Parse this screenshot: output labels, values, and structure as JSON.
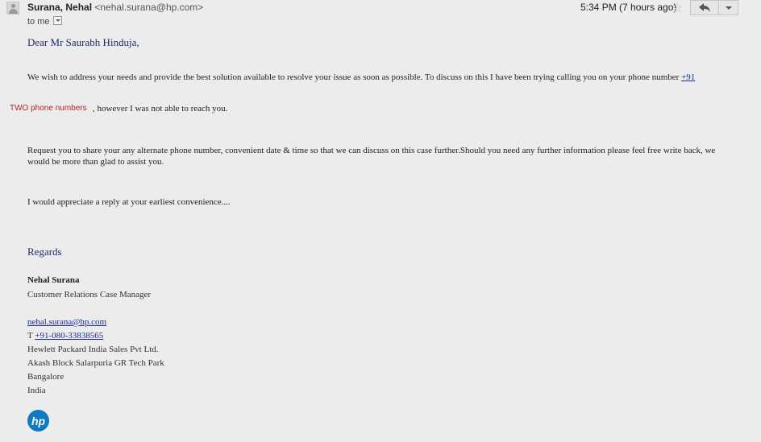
{
  "header": {
    "sender_name": "Surana, Nehal",
    "sender_email": "<nehal.surana@hp.com>",
    "recipient": "to me",
    "timestamp": "5:34 PM (7 hours ago)",
    "icons": {
      "avatar": "person-silhouette-icon",
      "details": "chevron-down-icon",
      "star": "star-icon",
      "reply": "reply-arrow-icon",
      "more": "dropdown-arrow-icon"
    }
  },
  "body": {
    "greeting": "Dear Mr Saurabh Hinduja,",
    "para1": "We wish to address your needs and provide the best solution available to resolve your issue as soon as possible. To discuss on this I have been trying calling you on your phone number",
    "para1_link": "+91",
    "redaction_note": "TWO phone numbers",
    "para1_cont": ", however I was not able to reach you.",
    "para2": "Request you to share your any alternate phone number, convenient date & time so that we can discuss on this case further.Should you need any further information please feel free write back, we would be more than glad to assist you.",
    "para3": "I would appreciate a reply at your earliest convenience....",
    "closing": "Regards"
  },
  "signature": {
    "name": "Nehal Surana",
    "title": "Customer Relations Case Manager",
    "email": "nehal.surana@hp.com",
    "phone_prefix": "T",
    "phone": "+91-080-33838565",
    "company": "Hewlett Packard India Sales Pvt Ltd.",
    "address1": "Akash Block Salarpuria GR Tech Park",
    "city": "Bangalore",
    "country": "India",
    "logo_text": "hp"
  },
  "colors": {
    "background": "#ececec",
    "heading_blue": "#1f2a6b",
    "link_blue": "#1a2c9c",
    "redaction_red": "#b22222",
    "hp_blue": "#0e7ac2"
  }
}
